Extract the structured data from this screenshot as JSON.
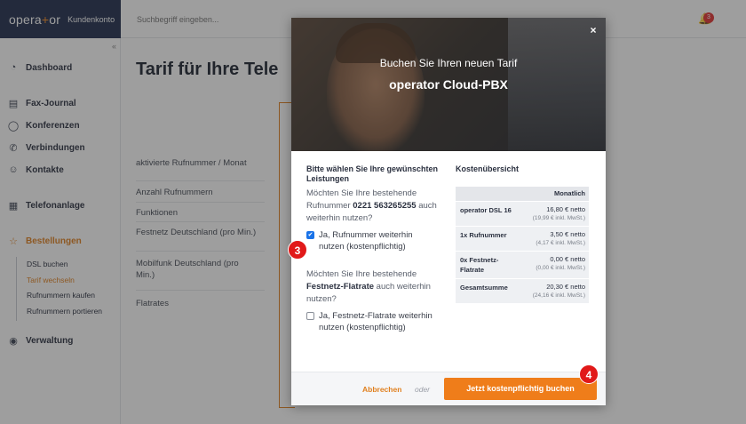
{
  "app": {
    "logo": "opera+or",
    "logo_sub": "Kundenkonto",
    "search_placeholder": "Suchbegriff eingeben...",
    "notification_count": "3"
  },
  "sidebar": {
    "items": [
      {
        "label": "Dashboard",
        "icon": "gauge-icon"
      },
      {
        "label": "Fax-Journal",
        "icon": "printer-icon"
      },
      {
        "label": "Konferenzen",
        "icon": "chat-icon"
      },
      {
        "label": "Verbindungen",
        "icon": "phone-icon"
      },
      {
        "label": "Kontakte",
        "icon": "contacts-icon"
      },
      {
        "label": "Telefonanlage",
        "icon": "building-icon"
      },
      {
        "label": "Bestellungen",
        "icon": "star-icon"
      },
      {
        "label": "Verwaltung",
        "icon": "user-circle-icon"
      }
    ],
    "subitems": [
      "DSL buchen",
      "Tarif wechseln",
      "Rufnummern kaufen",
      "Rufnummern portieren"
    ]
  },
  "main": {
    "title": "Tarif für Ihre Tele",
    "rows": [
      "aktivierte Rufnummer / Monat",
      "Anzahl Rufnummern",
      "Funktionen",
      "Festnetz Deutschland (pro Min.)",
      "Mobilfunk Deutschland (pro Min.)",
      "Flatrates"
    ]
  },
  "modal": {
    "subtitle": "Buchen Sie Ihren neuen Tarif",
    "title": "operator Cloud-PBX",
    "close": "×",
    "services_title": "Bitte wählen Sie Ihre gewünschten Leistungen",
    "q1_pre": "Möchten Sie Ihre bestehende Rufnummer ",
    "q1_number": "0221 563265255",
    "q1_post": " auch weiterhin nutzen?",
    "opt1": "Ja, Rufnummer weiterhin nutzen (kostenpflichtig)",
    "q2_pre": "Möchten Sie Ihre bestehende ",
    "q2_bold": "Festnetz-Flatrate",
    "q2_post": " auch weiterhin nutzen?",
    "opt2": "Ja, Festnetz-Flatrate weiterhin nutzen (kostenpflichtig)",
    "cost_title": "Kostenübersicht",
    "cost_head": "Monatlich",
    "cost_rows": [
      {
        "name": "operator DSL 16",
        "net": "16,80 € netto",
        "gross": "(19,99 € inkl. MwSt.)"
      },
      {
        "name": "1x Rufnummer",
        "net": "3,50 € netto",
        "gross": "(4,17 € inkl. MwSt.)"
      },
      {
        "name": "0x Festnetz-Flatrate",
        "net": "0,00 € netto",
        "gross": "(0,00 € inkl. MwSt.)"
      },
      {
        "name": "Gesamtsumme",
        "net": "20,30 € netto",
        "gross": "(24,16 € inkl. MwSt.)"
      }
    ],
    "cancel": "Abbrechen",
    "or": "oder",
    "book": "Jetzt kostenpflichtig buchen"
  },
  "steps": [
    "3",
    "4"
  ],
  "colors": {
    "accent": "#ef7d1a",
    "navy": "#1f2d4d",
    "step": "#e11919",
    "checkbox": "#1a73e8"
  }
}
